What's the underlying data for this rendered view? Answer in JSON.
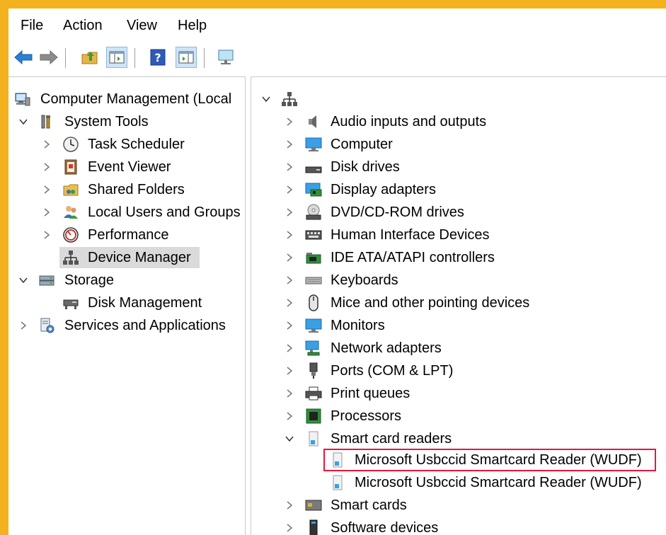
{
  "menu": [
    "File",
    "Action",
    "View",
    "Help"
  ],
  "toolbar": {
    "icons": [
      "back-arrow-icon",
      "forward-arrow-icon",
      "up-folder-icon",
      "show-hide-tree-icon",
      "help-icon",
      "action-pane-icon",
      "monitor-icon"
    ]
  },
  "left_tree": {
    "root": "Computer Management (Local",
    "system_tools": "System Tools",
    "task_scheduler": "Task Scheduler",
    "event_viewer": "Event Viewer",
    "shared_folders": "Shared Folders",
    "local_users": "Local Users and Groups",
    "performance": "Performance",
    "device_manager": "Device Manager",
    "storage": "Storage",
    "disk_management": "Disk Management",
    "services": "Services and Applications"
  },
  "devices": {
    "audio": "Audio inputs and outputs",
    "computer": "Computer",
    "disk": "Disk drives",
    "display": "Display adapters",
    "dvd": "DVD/CD-ROM drives",
    "hid": "Human Interface Devices",
    "ide": "IDE ATA/ATAPI controllers",
    "keyboards": "Keyboards",
    "mice": "Mice and other pointing devices",
    "monitors": "Monitors",
    "network": "Network adapters",
    "ports": "Ports (COM & LPT)",
    "print": "Print queues",
    "processors": "Processors",
    "smartcard_readers": "Smart card readers",
    "reader1": "Microsoft Usbccid Smartcard Reader (WUDF)",
    "reader2": "Microsoft Usbccid Smartcard Reader (WUDF)",
    "smartcards": "Smart cards",
    "software": "Software devices"
  },
  "colors": {
    "frame": "#f5b21f",
    "highlight": "#e8163c",
    "selected": "#dadada"
  }
}
